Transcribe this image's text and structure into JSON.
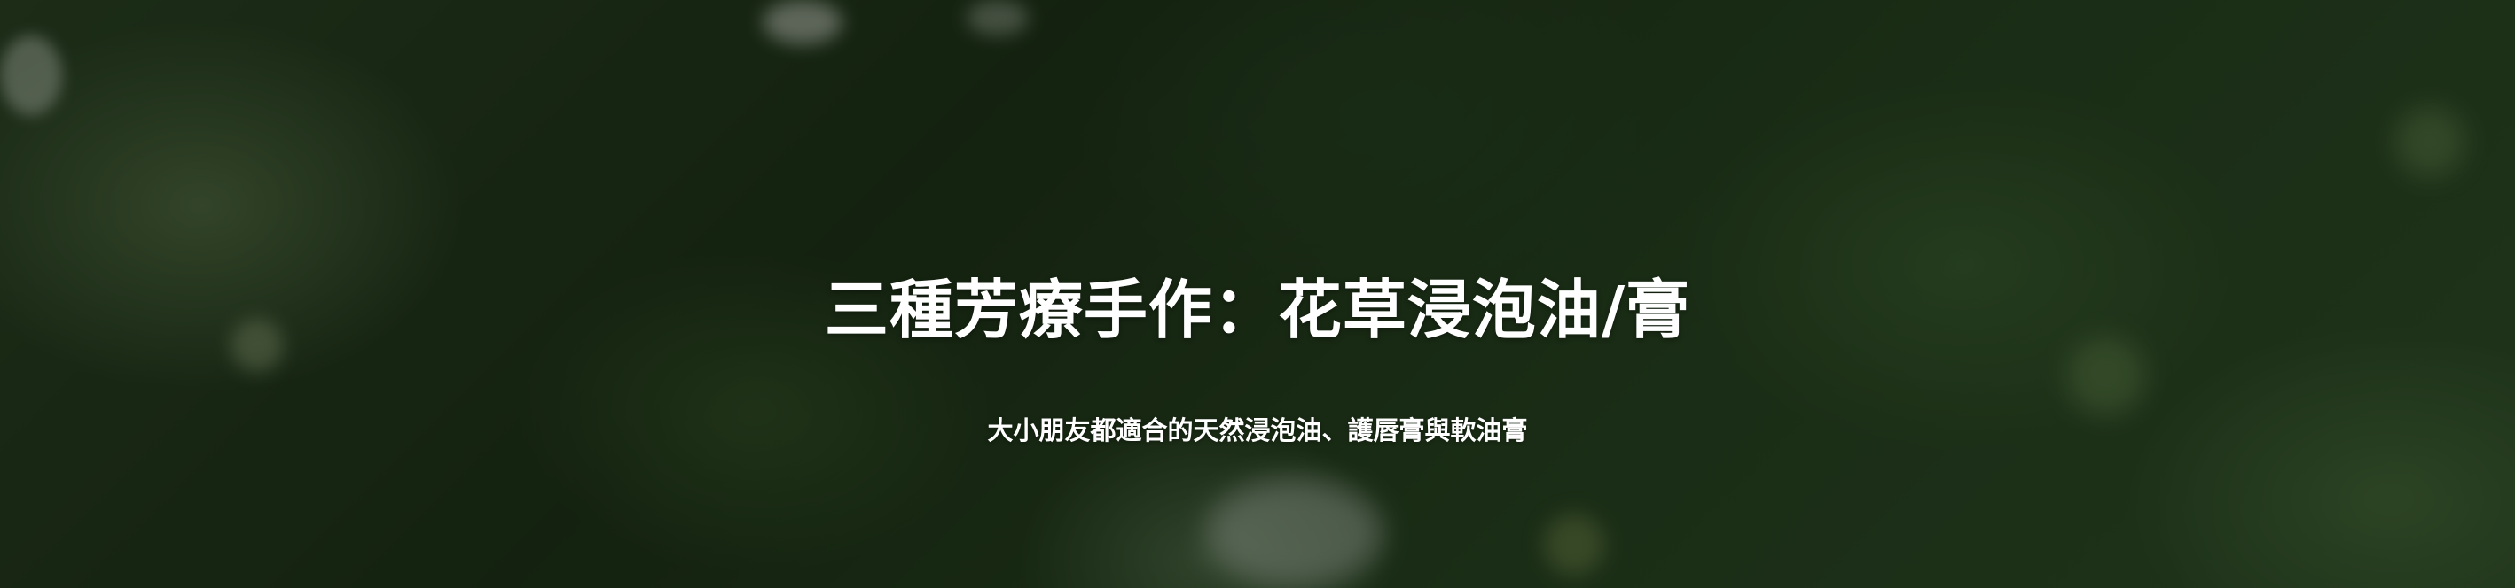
{
  "hero": {
    "title": "三種芳療手作：花草浸泡油/膏",
    "subtitle": "大小朋友都適合的天然浸泡油、護唇膏與軟油膏"
  }
}
